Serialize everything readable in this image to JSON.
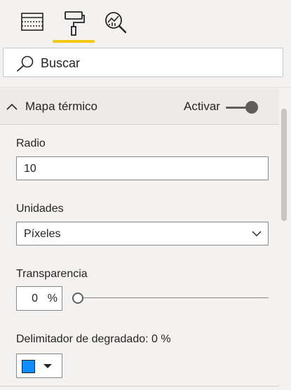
{
  "toolbar": {
    "tools": [
      {
        "name": "fields-icon",
        "active": false
      },
      {
        "name": "format-paint-roller-icon",
        "active": true
      },
      {
        "name": "analytics-icon",
        "active": false
      }
    ],
    "active_accent": "#f2c811"
  },
  "search": {
    "placeholder": "Buscar",
    "icon": "search-icon"
  },
  "section": {
    "title": "Mapa térmico",
    "toggle_label": "Activar",
    "toggle_on": true
  },
  "fields": {
    "radius": {
      "label": "Radio",
      "value": "10"
    },
    "units": {
      "label": "Unidades",
      "value": "Píxeles"
    },
    "transparency": {
      "label": "Transparencia",
      "value": "0",
      "unit": "%",
      "slider_fraction": 0
    },
    "gradient_stop": {
      "label": "Delimitador de degradado: 0 %",
      "color": "#118dff"
    }
  },
  "colors": {
    "background": "#f3f2f1",
    "section_header": "#edebe9",
    "input_border": "#8a8886",
    "text": "#252423"
  }
}
